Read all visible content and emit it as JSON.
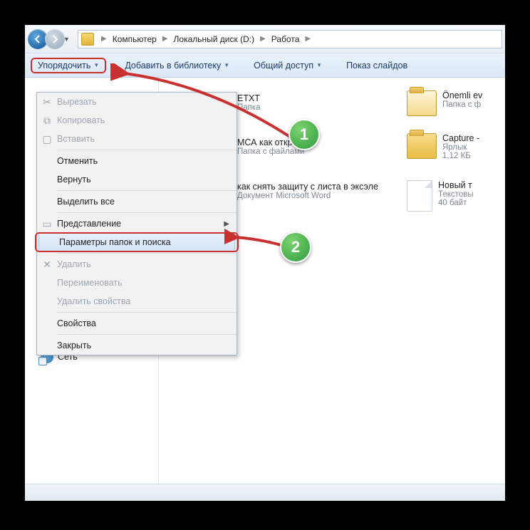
{
  "breadcrumb": {
    "items": [
      "Компьютер",
      "Локальный диск (D:)",
      "Работа"
    ]
  },
  "toolbar": {
    "organize": "Упорядочить",
    "add_library": "Добавить в библиотеку",
    "share": "Общий доступ",
    "slideshow": "Показ слайдов"
  },
  "menu": {
    "cut": "Вырезать",
    "copy": "Копировать",
    "paste": "Вставить",
    "undo": "Отменить",
    "redo": "Вернуть",
    "select_all": "Выделить все",
    "view": "Представление",
    "folder_options": "Параметры папок и поиска",
    "delete": "Удалить",
    "rename": "Переименовать",
    "remove_props": "Удалить свойства",
    "properties": "Свойства",
    "close": "Закрыть"
  },
  "sidebar": {
    "network": "Сеть"
  },
  "files": {
    "col1": [
      {
        "name_suffix": "ETXT",
        "sub": "Папка"
      },
      {
        "name": "МСА как открыть",
        "sub": "Папка с файлами"
      },
      {
        "name": "как снять защиту с листа в эксэле",
        "sub": "Документ Microsoft Word"
      }
    ],
    "col2": [
      {
        "name": "Önemli ev",
        "sub": "Папка с ф"
      },
      {
        "name": "Capture -",
        "sub1": "Ярлык",
        "sub2": "1,12 КБ"
      },
      {
        "name": "Новый т",
        "sub1": "Текстовы",
        "sub2": "40 байт"
      }
    ]
  },
  "badges": {
    "one": "1",
    "two": "2"
  }
}
